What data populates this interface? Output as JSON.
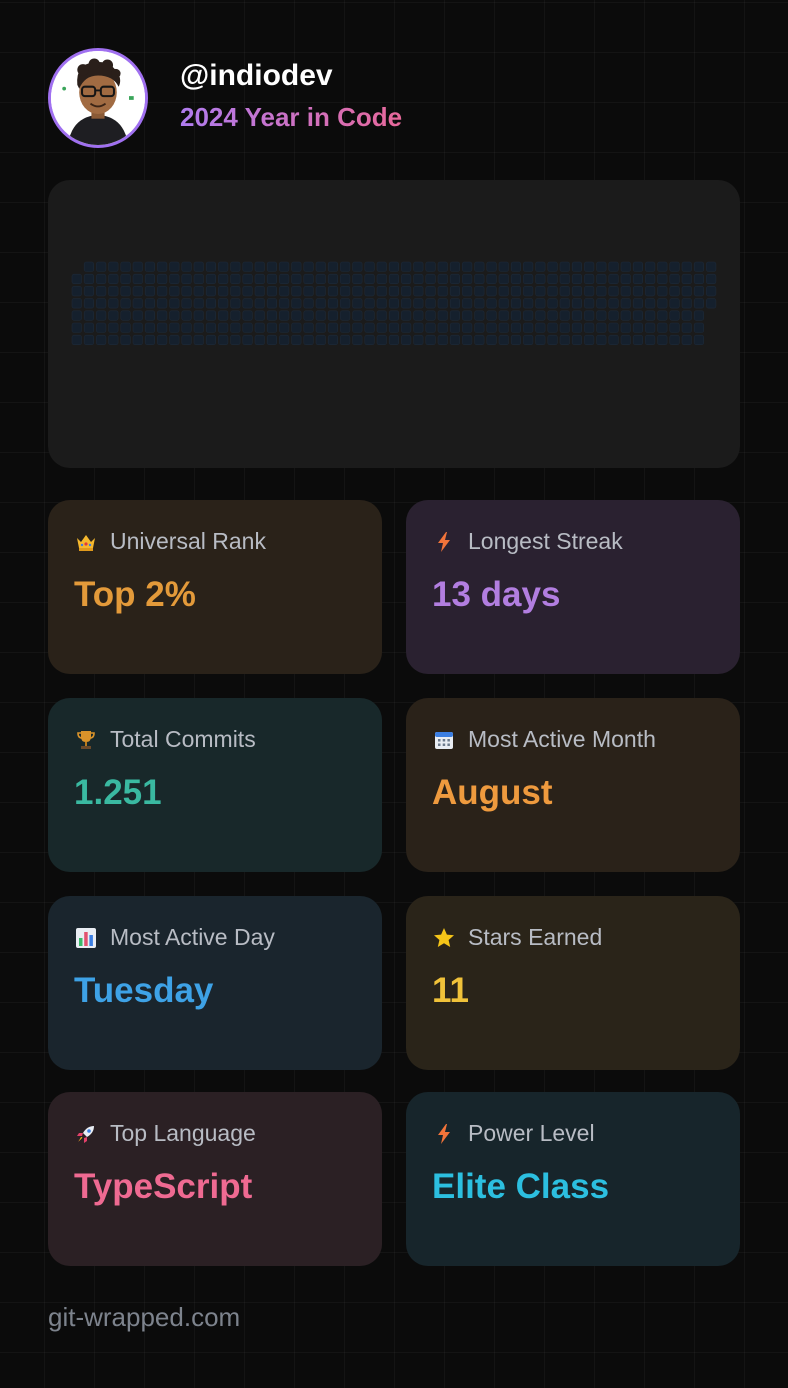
{
  "profile": {
    "username": "@indiodev",
    "subtitle": "2024 Year in Code"
  },
  "stats": [
    {
      "label": "Universal Rank",
      "value": "Top 2%",
      "icon": "crown-icon",
      "color": "#e39a3a",
      "bg": "#2a2219"
    },
    {
      "label": "Longest Streak",
      "value": "13 days",
      "icon": "lightning-icon",
      "color": "#b27ee0",
      "bg": "#2a2130"
    },
    {
      "label": "Total Commits",
      "value": "1.251",
      "icon": "trophy-icon",
      "color": "#3ab9a1",
      "bg": "#18282a"
    },
    {
      "label": "Most Active Month",
      "value": "August",
      "icon": "calendar-icon",
      "color": "#ee9a3e",
      "bg": "#2a2219"
    },
    {
      "label": "Most Active Day",
      "value": "Tuesday",
      "icon": "bar-chart-icon",
      "color": "#3ea2e6",
      "bg": "#1a252d"
    },
    {
      "label": "Stars Earned",
      "value": "11",
      "icon": "star-icon",
      "color": "#f0c23a",
      "bg": "#2a2419"
    },
    {
      "label": "Top Language",
      "value": "TypeScript",
      "icon": "rocket-icon",
      "color": "#ef6a92",
      "bg": "#2b2024"
    },
    {
      "label": "Power Level",
      "value": "Elite Class",
      "icon": "lightning-icon",
      "color": "#2cbfe0",
      "bg": "#17252b"
    }
  ],
  "footer": {
    "text": "git-wrapped.com"
  }
}
